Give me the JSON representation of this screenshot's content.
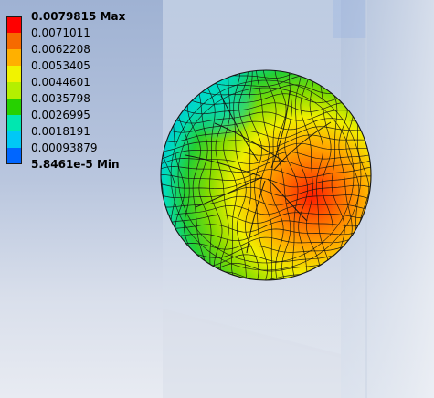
{
  "legend": {
    "entries": [
      {
        "value": "0.0079815",
        "suffix": "Max",
        "color": "#ff0000"
      },
      {
        "value": "0.0071011",
        "suffix": "",
        "color": "#f66a00"
      },
      {
        "value": "0.0062208",
        "suffix": "",
        "color": "#ffb000"
      },
      {
        "value": "0.0053405",
        "suffix": "",
        "color": "#f1f300"
      },
      {
        "value": "0.0044601",
        "suffix": "",
        "color": "#b4ef00"
      },
      {
        "value": "0.0035798",
        "suffix": "",
        "color": "#26d100"
      },
      {
        "value": "0.0026995",
        "suffix": "",
        "color": "#00e7b0"
      },
      {
        "value": "0.0018191",
        "suffix": "",
        "color": "#00c8f6"
      },
      {
        "value": "0.00093879",
        "suffix": "",
        "color": "#0066ff"
      },
      {
        "value": "5.8461e-5",
        "suffix": "Min",
        "color": "#0000c7"
      }
    ]
  },
  "colors": {
    "background_top": "#9fb2d3",
    "background_bottom": "#e8ebf2",
    "mesh_line": "#111111",
    "panel": "#c9d6ea"
  }
}
